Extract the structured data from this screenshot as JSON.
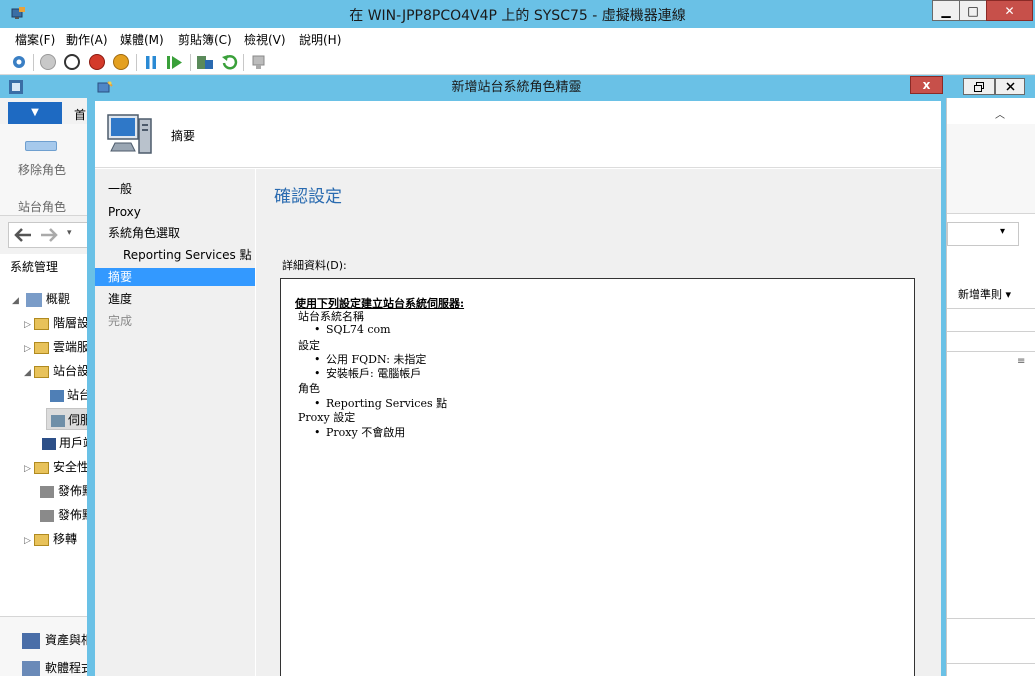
{
  "host": {
    "title": "在 WIN-JPP8PCO4V4P 上的 SYSC75 - 虛擬機器連線",
    "menu": [
      "檔案(F)",
      "動作(A)",
      "媒體(M)",
      "剪貼簿(C)",
      "檢視(V)",
      "說明(H)"
    ],
    "window_buttons": [
      "▁",
      "□",
      "✕"
    ]
  },
  "console": {
    "ribbon_tab": "▼",
    "ribbon_tab_peek": "首",
    "remove_role": "移除角色",
    "site_role": "站台角色",
    "section_title": "系統管理",
    "tree": [
      {
        "label": "概觀",
        "arrow": "◢"
      },
      {
        "label": "階層設",
        "arrow": "▷"
      },
      {
        "label": "雲端服",
        "arrow": "▷"
      },
      {
        "label": "站台設",
        "arrow": "◢"
      },
      {
        "label": "站台",
        "arrow": ""
      },
      {
        "label": "伺服",
        "arrow": ""
      },
      {
        "label": "用戶端",
        "arrow": ""
      },
      {
        "label": "安全性",
        "arrow": "▷"
      },
      {
        "label": "發佈點",
        "arrow": ""
      },
      {
        "label": "發佈點",
        "arrow": ""
      },
      {
        "label": "移轉",
        "arrow": "▷"
      }
    ],
    "bottom_nav": [
      "資產與相",
      "軟體程式"
    ],
    "right_action": "新增準則 ▾"
  },
  "wizard": {
    "title": "新增站台系統角色精靈",
    "close": "x",
    "header_label": "摘要",
    "nav": [
      {
        "label": "一般",
        "state": "normal"
      },
      {
        "label": "Proxy",
        "state": "normal"
      },
      {
        "label": "系統角色選取",
        "state": "normal"
      },
      {
        "label": "Reporting Services 點",
        "state": "sub"
      },
      {
        "label": "摘要",
        "state": "active"
      },
      {
        "label": "進度",
        "state": "normal"
      },
      {
        "label": "完成",
        "state": "disabled"
      }
    ],
    "content_title": "確認設定",
    "details_label": "詳細資料(D):",
    "details": {
      "heading": "使用下列設定建立站台系統伺服器:",
      "lines": [
        {
          "text": "站台系統名稱",
          "bullet": false
        },
        {
          "text": "SQL74          com",
          "bullet": true
        },
        {
          "text": "設定",
          "bullet": false
        },
        {
          "text": "公用 FQDN: 未指定",
          "bullet": true
        },
        {
          "text": "安裝帳戶: 電腦帳戶",
          "bullet": true
        },
        {
          "text": "角色",
          "bullet": false
        },
        {
          "text": "Reporting Services 點",
          "bullet": true
        },
        {
          "text": "Proxy 設定",
          "bullet": false
        },
        {
          "text": "Proxy 不會啟用",
          "bullet": true
        }
      ]
    }
  },
  "colors": {
    "title_bar": "#6ac1e6",
    "active_step": "#3399ff",
    "content_title": "#2a6bb0",
    "close_button": "#c7504a"
  }
}
